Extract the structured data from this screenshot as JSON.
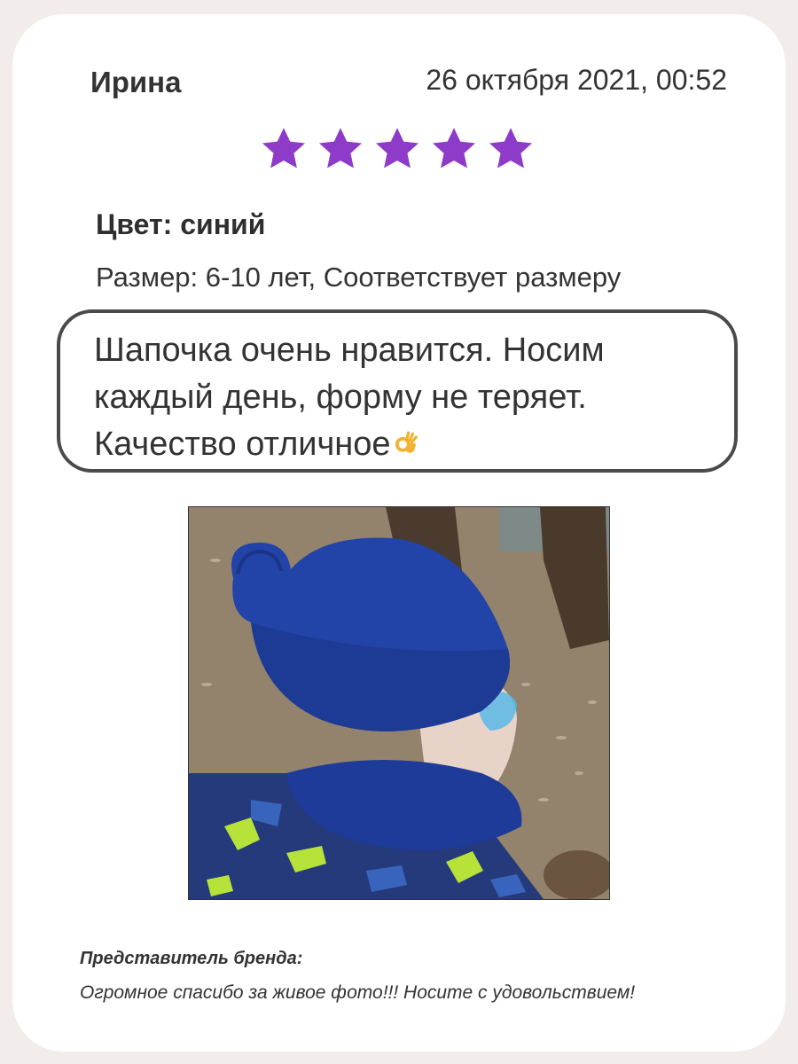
{
  "review": {
    "author": "Ирина",
    "date": "26 октября 2021, 00:52",
    "rating": 5,
    "rating_max": 5,
    "star_color": "#8e3bc9",
    "color_line": "Цвет: синий",
    "size_line": "Размер: 6-10 лет, Соответствует размеру",
    "text": "Шапочка очень нравится. Носим каждый день, форму не теряет. Качество отличное",
    "text_emoji": "ok-hand-emoji-icon"
  },
  "photo": {
    "subject": "review-photo"
  },
  "brand_reply": {
    "label": "Представитель бренда:",
    "text": "Огромное спасибо за живое фото!!! Носите с удовольствием!"
  },
  "colors": {
    "background": "#f2ecea",
    "card": "#ffffff",
    "bubble_border": "#4a4a4a"
  }
}
